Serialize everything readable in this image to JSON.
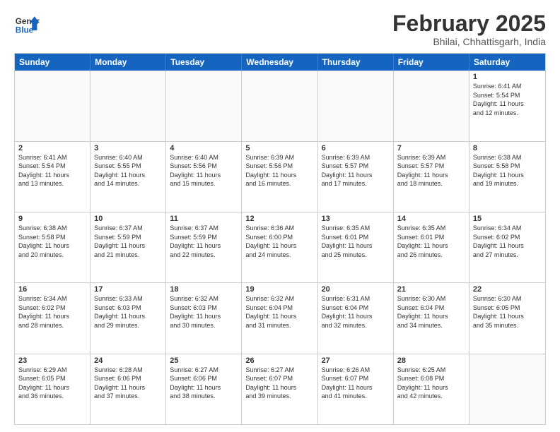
{
  "header": {
    "logo_general": "General",
    "logo_blue": "Blue",
    "month_title": "February 2025",
    "location": "Bhilai, Chhattisgarh, India"
  },
  "weekdays": [
    "Sunday",
    "Monday",
    "Tuesday",
    "Wednesday",
    "Thursday",
    "Friday",
    "Saturday"
  ],
  "rows": [
    [
      {
        "day": "",
        "text": "",
        "empty": true
      },
      {
        "day": "",
        "text": "",
        "empty": true
      },
      {
        "day": "",
        "text": "",
        "empty": true
      },
      {
        "day": "",
        "text": "",
        "empty": true
      },
      {
        "day": "",
        "text": "",
        "empty": true
      },
      {
        "day": "",
        "text": "",
        "empty": true
      },
      {
        "day": "1",
        "text": "Sunrise: 6:41 AM\nSunset: 5:54 PM\nDaylight: 11 hours\nand 12 minutes.",
        "empty": false
      }
    ],
    [
      {
        "day": "2",
        "text": "Sunrise: 6:41 AM\nSunset: 5:54 PM\nDaylight: 11 hours\nand 13 minutes.",
        "empty": false
      },
      {
        "day": "3",
        "text": "Sunrise: 6:40 AM\nSunset: 5:55 PM\nDaylight: 11 hours\nand 14 minutes.",
        "empty": false
      },
      {
        "day": "4",
        "text": "Sunrise: 6:40 AM\nSunset: 5:56 PM\nDaylight: 11 hours\nand 15 minutes.",
        "empty": false
      },
      {
        "day": "5",
        "text": "Sunrise: 6:39 AM\nSunset: 5:56 PM\nDaylight: 11 hours\nand 16 minutes.",
        "empty": false
      },
      {
        "day": "6",
        "text": "Sunrise: 6:39 AM\nSunset: 5:57 PM\nDaylight: 11 hours\nand 17 minutes.",
        "empty": false
      },
      {
        "day": "7",
        "text": "Sunrise: 6:39 AM\nSunset: 5:57 PM\nDaylight: 11 hours\nand 18 minutes.",
        "empty": false
      },
      {
        "day": "8",
        "text": "Sunrise: 6:38 AM\nSunset: 5:58 PM\nDaylight: 11 hours\nand 19 minutes.",
        "empty": false
      }
    ],
    [
      {
        "day": "9",
        "text": "Sunrise: 6:38 AM\nSunset: 5:58 PM\nDaylight: 11 hours\nand 20 minutes.",
        "empty": false
      },
      {
        "day": "10",
        "text": "Sunrise: 6:37 AM\nSunset: 5:59 PM\nDaylight: 11 hours\nand 21 minutes.",
        "empty": false
      },
      {
        "day": "11",
        "text": "Sunrise: 6:37 AM\nSunset: 5:59 PM\nDaylight: 11 hours\nand 22 minutes.",
        "empty": false
      },
      {
        "day": "12",
        "text": "Sunrise: 6:36 AM\nSunset: 6:00 PM\nDaylight: 11 hours\nand 24 minutes.",
        "empty": false
      },
      {
        "day": "13",
        "text": "Sunrise: 6:35 AM\nSunset: 6:01 PM\nDaylight: 11 hours\nand 25 minutes.",
        "empty": false
      },
      {
        "day": "14",
        "text": "Sunrise: 6:35 AM\nSunset: 6:01 PM\nDaylight: 11 hours\nand 26 minutes.",
        "empty": false
      },
      {
        "day": "15",
        "text": "Sunrise: 6:34 AM\nSunset: 6:02 PM\nDaylight: 11 hours\nand 27 minutes.",
        "empty": false
      }
    ],
    [
      {
        "day": "16",
        "text": "Sunrise: 6:34 AM\nSunset: 6:02 PM\nDaylight: 11 hours\nand 28 minutes.",
        "empty": false
      },
      {
        "day": "17",
        "text": "Sunrise: 6:33 AM\nSunset: 6:03 PM\nDaylight: 11 hours\nand 29 minutes.",
        "empty": false
      },
      {
        "day": "18",
        "text": "Sunrise: 6:32 AM\nSunset: 6:03 PM\nDaylight: 11 hours\nand 30 minutes.",
        "empty": false
      },
      {
        "day": "19",
        "text": "Sunrise: 6:32 AM\nSunset: 6:04 PM\nDaylight: 11 hours\nand 31 minutes.",
        "empty": false
      },
      {
        "day": "20",
        "text": "Sunrise: 6:31 AM\nSunset: 6:04 PM\nDaylight: 11 hours\nand 32 minutes.",
        "empty": false
      },
      {
        "day": "21",
        "text": "Sunrise: 6:30 AM\nSunset: 6:04 PM\nDaylight: 11 hours\nand 34 minutes.",
        "empty": false
      },
      {
        "day": "22",
        "text": "Sunrise: 6:30 AM\nSunset: 6:05 PM\nDaylight: 11 hours\nand 35 minutes.",
        "empty": false
      }
    ],
    [
      {
        "day": "23",
        "text": "Sunrise: 6:29 AM\nSunset: 6:05 PM\nDaylight: 11 hours\nand 36 minutes.",
        "empty": false
      },
      {
        "day": "24",
        "text": "Sunrise: 6:28 AM\nSunset: 6:06 PM\nDaylight: 11 hours\nand 37 minutes.",
        "empty": false
      },
      {
        "day": "25",
        "text": "Sunrise: 6:27 AM\nSunset: 6:06 PM\nDaylight: 11 hours\nand 38 minutes.",
        "empty": false
      },
      {
        "day": "26",
        "text": "Sunrise: 6:27 AM\nSunset: 6:07 PM\nDaylight: 11 hours\nand 39 minutes.",
        "empty": false
      },
      {
        "day": "27",
        "text": "Sunrise: 6:26 AM\nSunset: 6:07 PM\nDaylight: 11 hours\nand 41 minutes.",
        "empty": false
      },
      {
        "day": "28",
        "text": "Sunrise: 6:25 AM\nSunset: 6:08 PM\nDaylight: 11 hours\nand 42 minutes.",
        "empty": false
      },
      {
        "day": "",
        "text": "",
        "empty": true
      }
    ]
  ]
}
